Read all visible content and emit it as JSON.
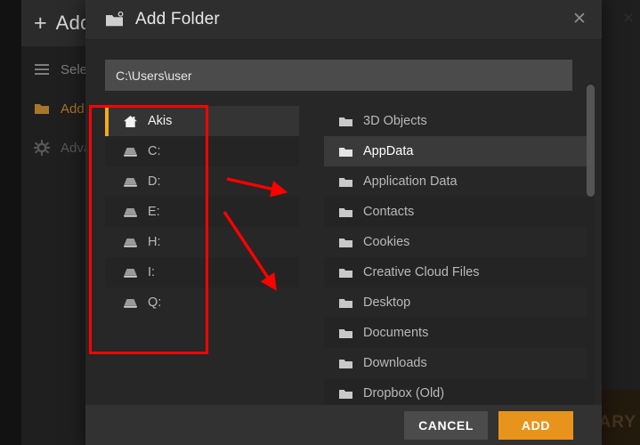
{
  "background": {
    "header": {
      "plus_icon": "plus-icon",
      "title": "Add"
    },
    "menu": [
      {
        "icon": "hamburger-icon",
        "label": "Select",
        "style": "normal"
      },
      {
        "icon": "folder-icon",
        "label": "Add folder",
        "style": "accent"
      },
      {
        "icon": "gear-icon",
        "label": "Advanced",
        "style": "faint"
      }
    ],
    "close_icon": "close-icon",
    "watermark": "RARY"
  },
  "modal": {
    "title": "Add Folder",
    "title_icon": "folder-add-icon",
    "close_icon": "close-icon",
    "path": {
      "value": "C:\\Users\\user",
      "placeholder": "C:\\Users\\user"
    },
    "places": [
      {
        "label": "Akis",
        "icon": "home-icon",
        "selected": true
      },
      {
        "label": "C:",
        "icon": "drive-icon",
        "selected": false
      },
      {
        "label": "D:",
        "icon": "drive-icon",
        "selected": false
      },
      {
        "label": "E:",
        "icon": "drive-icon",
        "selected": false
      },
      {
        "label": "H:",
        "icon": "drive-icon",
        "selected": false
      },
      {
        "label": "I:",
        "icon": "drive-icon",
        "selected": false
      },
      {
        "label": "Q:",
        "icon": "drive-icon",
        "selected": false
      }
    ],
    "folders": [
      {
        "label": "3D Objects",
        "icon": "folder-icon",
        "selected": false
      },
      {
        "label": "AppData",
        "icon": "folder-icon",
        "selected": true
      },
      {
        "label": "Application Data",
        "icon": "folder-icon",
        "selected": false
      },
      {
        "label": "Contacts",
        "icon": "folder-icon",
        "selected": false
      },
      {
        "label": "Cookies",
        "icon": "folder-icon",
        "selected": false
      },
      {
        "label": "Creative Cloud Files",
        "icon": "folder-icon",
        "selected": false
      },
      {
        "label": "Desktop",
        "icon": "folder-icon",
        "selected": false
      },
      {
        "label": "Documents",
        "icon": "folder-icon",
        "selected": false
      },
      {
        "label": "Downloads",
        "icon": "folder-icon",
        "selected": false
      },
      {
        "label": "Dropbox (Old)",
        "icon": "folder-icon",
        "selected": false
      }
    ],
    "buttons": {
      "cancel": "CANCEL",
      "add": "ADD"
    }
  },
  "colors": {
    "accent_orange": "#e8941c",
    "selected_marker": "#f0a91e",
    "annotation_red": "#ff0000",
    "modal_bg": "#272727",
    "header_bg": "#2e2e2e",
    "footer_bg": "#323232",
    "input_bg": "#4b4b4b"
  }
}
